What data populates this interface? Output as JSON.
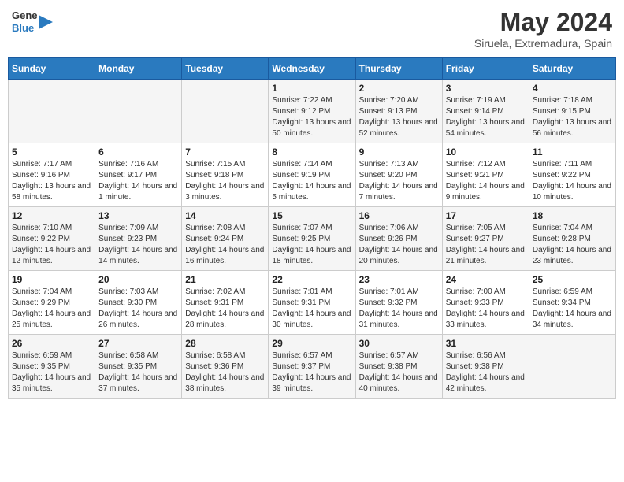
{
  "header": {
    "logo_line1": "General",
    "logo_line2": "Blue",
    "month_year": "May 2024",
    "location": "Siruela, Extremadura, Spain"
  },
  "weekdays": [
    "Sunday",
    "Monday",
    "Tuesday",
    "Wednesday",
    "Thursday",
    "Friday",
    "Saturday"
  ],
  "weeks": [
    [
      {
        "day": "",
        "info": ""
      },
      {
        "day": "",
        "info": ""
      },
      {
        "day": "",
        "info": ""
      },
      {
        "day": "1",
        "info": "Sunrise: 7:22 AM\nSunset: 9:12 PM\nDaylight: 13 hours and 50 minutes."
      },
      {
        "day": "2",
        "info": "Sunrise: 7:20 AM\nSunset: 9:13 PM\nDaylight: 13 hours and 52 minutes."
      },
      {
        "day": "3",
        "info": "Sunrise: 7:19 AM\nSunset: 9:14 PM\nDaylight: 13 hours and 54 minutes."
      },
      {
        "day": "4",
        "info": "Sunrise: 7:18 AM\nSunset: 9:15 PM\nDaylight: 13 hours and 56 minutes."
      }
    ],
    [
      {
        "day": "5",
        "info": "Sunrise: 7:17 AM\nSunset: 9:16 PM\nDaylight: 13 hours and 58 minutes."
      },
      {
        "day": "6",
        "info": "Sunrise: 7:16 AM\nSunset: 9:17 PM\nDaylight: 14 hours and 1 minute."
      },
      {
        "day": "7",
        "info": "Sunrise: 7:15 AM\nSunset: 9:18 PM\nDaylight: 14 hours and 3 minutes."
      },
      {
        "day": "8",
        "info": "Sunrise: 7:14 AM\nSunset: 9:19 PM\nDaylight: 14 hours and 5 minutes."
      },
      {
        "day": "9",
        "info": "Sunrise: 7:13 AM\nSunset: 9:20 PM\nDaylight: 14 hours and 7 minutes."
      },
      {
        "day": "10",
        "info": "Sunrise: 7:12 AM\nSunset: 9:21 PM\nDaylight: 14 hours and 9 minutes."
      },
      {
        "day": "11",
        "info": "Sunrise: 7:11 AM\nSunset: 9:22 PM\nDaylight: 14 hours and 10 minutes."
      }
    ],
    [
      {
        "day": "12",
        "info": "Sunrise: 7:10 AM\nSunset: 9:22 PM\nDaylight: 14 hours and 12 minutes."
      },
      {
        "day": "13",
        "info": "Sunrise: 7:09 AM\nSunset: 9:23 PM\nDaylight: 14 hours and 14 minutes."
      },
      {
        "day": "14",
        "info": "Sunrise: 7:08 AM\nSunset: 9:24 PM\nDaylight: 14 hours and 16 minutes."
      },
      {
        "day": "15",
        "info": "Sunrise: 7:07 AM\nSunset: 9:25 PM\nDaylight: 14 hours and 18 minutes."
      },
      {
        "day": "16",
        "info": "Sunrise: 7:06 AM\nSunset: 9:26 PM\nDaylight: 14 hours and 20 minutes."
      },
      {
        "day": "17",
        "info": "Sunrise: 7:05 AM\nSunset: 9:27 PM\nDaylight: 14 hours and 21 minutes."
      },
      {
        "day": "18",
        "info": "Sunrise: 7:04 AM\nSunset: 9:28 PM\nDaylight: 14 hours and 23 minutes."
      }
    ],
    [
      {
        "day": "19",
        "info": "Sunrise: 7:04 AM\nSunset: 9:29 PM\nDaylight: 14 hours and 25 minutes."
      },
      {
        "day": "20",
        "info": "Sunrise: 7:03 AM\nSunset: 9:30 PM\nDaylight: 14 hours and 26 minutes."
      },
      {
        "day": "21",
        "info": "Sunrise: 7:02 AM\nSunset: 9:31 PM\nDaylight: 14 hours and 28 minutes."
      },
      {
        "day": "22",
        "info": "Sunrise: 7:01 AM\nSunset: 9:31 PM\nDaylight: 14 hours and 30 minutes."
      },
      {
        "day": "23",
        "info": "Sunrise: 7:01 AM\nSunset: 9:32 PM\nDaylight: 14 hours and 31 minutes."
      },
      {
        "day": "24",
        "info": "Sunrise: 7:00 AM\nSunset: 9:33 PM\nDaylight: 14 hours and 33 minutes."
      },
      {
        "day": "25",
        "info": "Sunrise: 6:59 AM\nSunset: 9:34 PM\nDaylight: 14 hours and 34 minutes."
      }
    ],
    [
      {
        "day": "26",
        "info": "Sunrise: 6:59 AM\nSunset: 9:35 PM\nDaylight: 14 hours and 35 minutes."
      },
      {
        "day": "27",
        "info": "Sunrise: 6:58 AM\nSunset: 9:35 PM\nDaylight: 14 hours and 37 minutes."
      },
      {
        "day": "28",
        "info": "Sunrise: 6:58 AM\nSunset: 9:36 PM\nDaylight: 14 hours and 38 minutes."
      },
      {
        "day": "29",
        "info": "Sunrise: 6:57 AM\nSunset: 9:37 PM\nDaylight: 14 hours and 39 minutes."
      },
      {
        "day": "30",
        "info": "Sunrise: 6:57 AM\nSunset: 9:38 PM\nDaylight: 14 hours and 40 minutes."
      },
      {
        "day": "31",
        "info": "Sunrise: 6:56 AM\nSunset: 9:38 PM\nDaylight: 14 hours and 42 minutes."
      },
      {
        "day": "",
        "info": ""
      }
    ]
  ]
}
